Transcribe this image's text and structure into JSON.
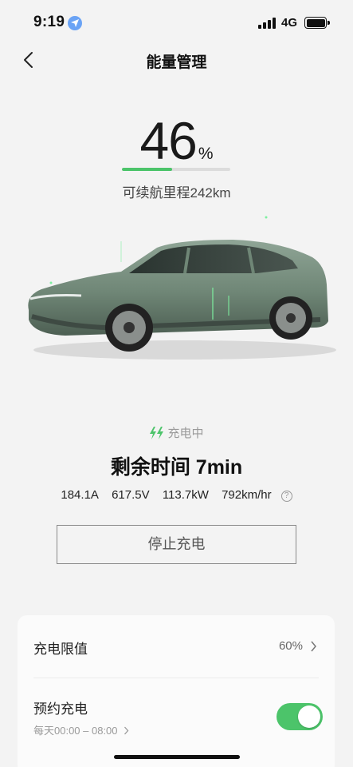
{
  "status_bar": {
    "time": "9:19",
    "network": "4G",
    "location_icon": "location-arrow-icon",
    "signal_icon": "signal-bars-icon",
    "battery_icon": "battery-full-icon"
  },
  "nav": {
    "title": "能量管理",
    "back_icon": "chevron-left-icon"
  },
  "battery": {
    "percent": "46",
    "unit": "%",
    "level_fraction": 0.46,
    "range_text": "可续航里程242km"
  },
  "vehicle_image": "green-station-wagon-car",
  "charging": {
    "status_label": "充电中",
    "status_icon": "charging-bolts-icon",
    "remaining_text": "剩余时间 7min",
    "metrics": [
      "184.1A",
      "617.5V",
      "113.7kW",
      "792km/hr"
    ],
    "help_icon": "question-circle-icon",
    "stop_button_label": "停止充电"
  },
  "settings": {
    "charge_limit_label": "充电限值",
    "charge_limit_value": "60%",
    "scheduled_label": "预约充电",
    "scheduled_subtitle": "每天00:00 – 08:00",
    "scheduled_enabled": true
  },
  "colors": {
    "accent_green": "#4cc46a",
    "background": "#f3f3f3"
  }
}
